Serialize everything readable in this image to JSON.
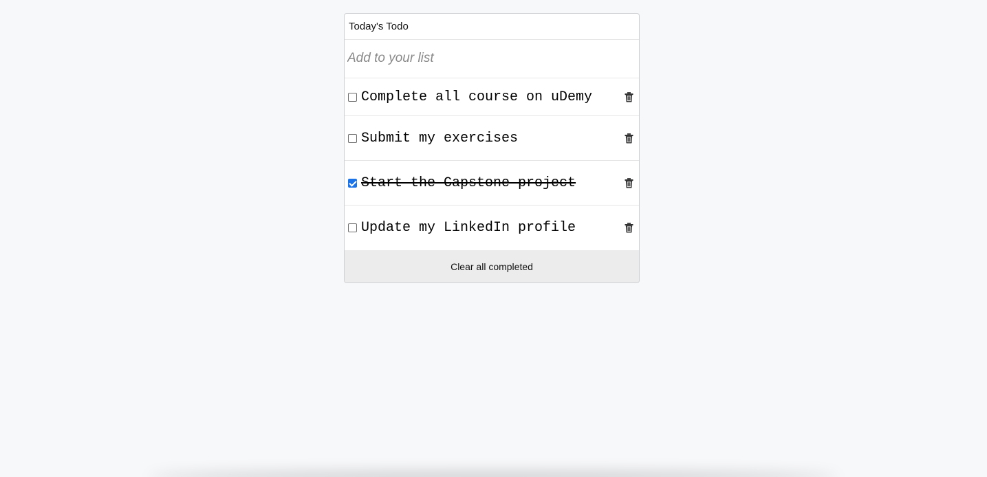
{
  "app": {
    "title": "Today's Todo"
  },
  "add": {
    "placeholder": "Add to your list"
  },
  "todos": [
    {
      "label": "Complete all course on uDemy",
      "completed": false
    },
    {
      "label": "Submit my exercises",
      "completed": false
    },
    {
      "label": "Start the Capstone project",
      "completed": true
    },
    {
      "label": "Update my LinkedIn profile",
      "completed": false
    }
  ],
  "footer": {
    "clear_label": "Clear all completed"
  },
  "icons": {
    "delete": "trash-icon"
  },
  "colors": {
    "checkbox_checked": "#1a73e8",
    "page_background": "#f7f8fa",
    "footer_background": "#ececec"
  }
}
